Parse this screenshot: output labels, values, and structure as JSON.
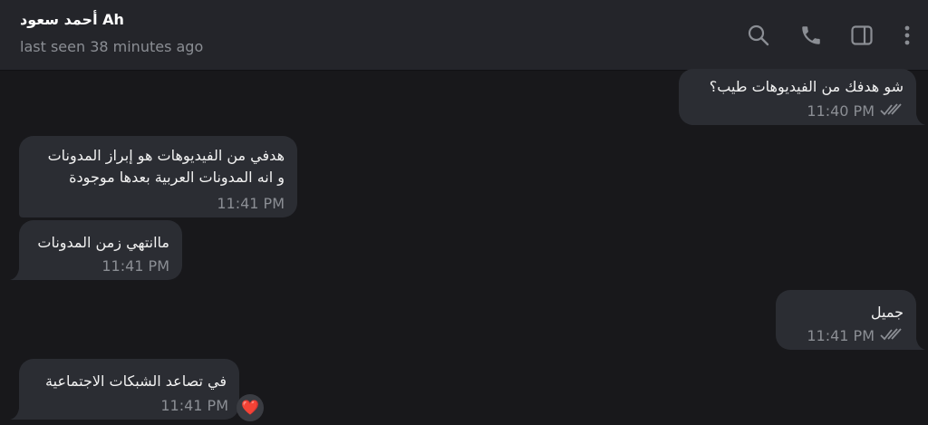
{
  "header": {
    "title": "أحمد سعود Ah",
    "status": "last seen 38 minutes ago"
  },
  "icons": {
    "search": "search-icon",
    "call": "phone-icon",
    "sidebar": "sidebar-toggle-icon",
    "more": "more-vertical-icon"
  },
  "messages": [
    {
      "direction": "outgoing",
      "text": "شو هدفك من الفيديوهات طيب؟",
      "time": "11:40 PM",
      "read": true
    },
    {
      "direction": "incoming",
      "lines": [
        "هدفي من الفيديوهات هو إبراز المدونات",
        "و انه المدونات العربية بعدها موجودة"
      ],
      "time": "11:41 PM"
    },
    {
      "direction": "incoming",
      "text": "ماانتهي زمن المدونات",
      "time": "11:41 PM"
    },
    {
      "direction": "outgoing",
      "text": "جميل",
      "time": "11:41 PM",
      "read": true
    },
    {
      "direction": "incoming",
      "text": "في تصاعد الشبكات الاجتماعية",
      "time": "11:41 PM",
      "reaction": "❤️"
    }
  ],
  "colors": {
    "background": "#18181b",
    "header": "#24252a",
    "bubble": "#2b2d33",
    "meta": "#8b8e94"
  }
}
